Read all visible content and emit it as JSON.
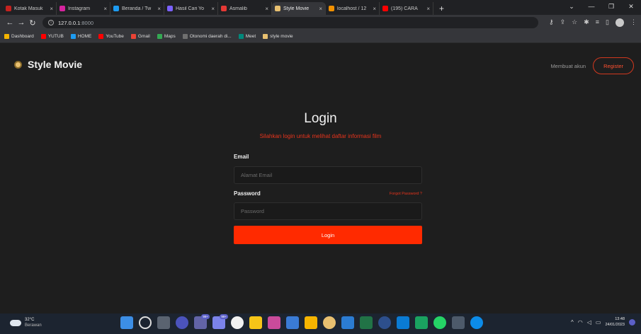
{
  "browser": {
    "tabs": [
      {
        "label": "Kotak Masuk",
        "color": "#c5221f",
        "active": false
      },
      {
        "label": "Instagram",
        "color": "#d6249f",
        "active": false
      },
      {
        "label": "Beranda / Tw",
        "color": "#1d9bf0",
        "active": false
      },
      {
        "label": "Hasil Cari Yo",
        "color": "#7b61ff",
        "active": false
      },
      {
        "label": "Asmalib",
        "color": "#e53935",
        "active": false
      },
      {
        "label": "Style Movie",
        "color": "#e8c070",
        "active": true
      },
      {
        "label": "localhost / 12",
        "color": "#f29100",
        "active": false
      },
      {
        "label": "(195) CARA",
        "color": "#ff0000",
        "active": false
      }
    ],
    "new_tab": "+",
    "url_host": "127.0.0.1",
    "url_port": ":8000",
    "bookmarks": [
      {
        "label": "Dashboard",
        "color": "#f4b400"
      },
      {
        "label": "YUTUB",
        "color": "#ff0000"
      },
      {
        "label": "HOME",
        "color": "#1d9bf0"
      },
      {
        "label": "YouTube",
        "color": "#ff0000"
      },
      {
        "label": "Gmail",
        "color": "#ea4335"
      },
      {
        "label": "Maps",
        "color": "#34a853"
      },
      {
        "label": "Otonomi daerah di...",
        "color": "#6f6f6f"
      },
      {
        "label": "Meet",
        "color": "#00897b"
      },
      {
        "label": "style movie",
        "color": "#e8c070"
      }
    ]
  },
  "page": {
    "brand": "Style Movie",
    "nav_link": "Membuat akun",
    "register_label": "Register",
    "login_title": "Login",
    "login_subtitle": "Silahkan login untuk melihat daftar informasi film",
    "email_label": "Email",
    "email_placeholder": "Alamat Email",
    "password_label": "Password",
    "forgot_label": "Forgot Password ?",
    "password_placeholder": "Password",
    "login_button": "Login",
    "accent": "#ff2a00"
  },
  "taskbar": {
    "temperature": "32°C",
    "condition": "Berawan",
    "badge_1": "99+",
    "badge_2": "99+",
    "time": "13:48",
    "date": "24/01/2023"
  }
}
